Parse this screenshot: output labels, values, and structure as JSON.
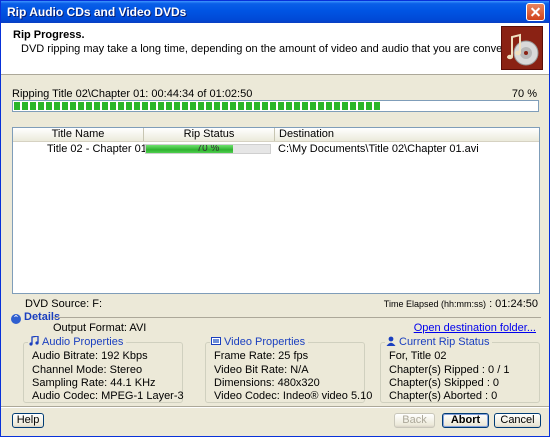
{
  "window": {
    "title": "Rip Audio CDs and Video DVDs"
  },
  "header": {
    "title": "Rip Progress.",
    "description": "DVD ripping may take a long time, depending on the amount of video and audio that you are converting."
  },
  "progress": {
    "label": "Ripping Title 02\\Chapter 01: 00:44:34 of 01:02:50",
    "percent_text": "70 %",
    "fraction": 0.7
  },
  "list": {
    "columns": {
      "title_name": "Title Name",
      "rip_status": "Rip Status",
      "destination": "Destination"
    },
    "rows": [
      {
        "title_name": "Title 02 - Chapter 01",
        "rip_status_text": "70 %",
        "rip_fraction": 0.7,
        "destination": "C:\\My Documents\\Title 02\\Chapter 01.avi"
      }
    ]
  },
  "status": {
    "dvd_source": "DVD Source: F:",
    "time_elapsed_label": "Time Elapsed (hh:mm:ss)",
    "time_elapsed_value": ": 01:24:50"
  },
  "details": {
    "heading": "Details",
    "output_format": "Output Format: AVI",
    "open_folder_link": "Open destination folder...",
    "audio": {
      "title": "Audio Properties",
      "bitrate": "Audio Bitrate: 192 Kbps",
      "channel_mode": "Channel Mode: Stereo",
      "sampling_rate": "Sampling Rate: 44.1 KHz",
      "codec": "Audio Codec: MPEG-1 Layer-3"
    },
    "video": {
      "title": "Video Properties",
      "frame_rate": "Frame Rate: 25 fps",
      "bitrate": "Video Bit Rate: N/A",
      "dimensions": "Dimensions: 480x320",
      "codec": "Video Codec: Indeo® video 5.10"
    },
    "current": {
      "title": "Current Rip Status",
      "for_title": "For, Title 02",
      "ripped": "Chapter(s) Ripped : 0 / 1",
      "skipped": "Chapter(s) Skipped : 0",
      "aborted": "Chapter(s) Aborted : 0"
    }
  },
  "buttons": {
    "help": "Help",
    "back": "Back",
    "abort": "Abort",
    "cancel": "Cancel"
  },
  "colors": {
    "titlebar": "#0054e3",
    "progress_green": "#29b629",
    "link": "#0000ee",
    "group_title": "#1a3fbf"
  }
}
